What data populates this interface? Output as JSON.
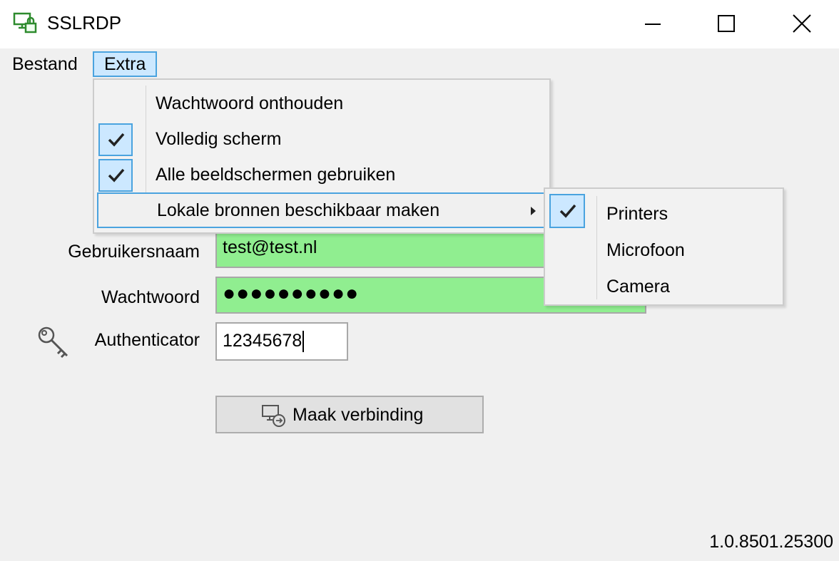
{
  "window": {
    "title": "SSLRDP",
    "app_icon": "monitor-lock-icon",
    "controls": [
      "minimize-icon",
      "maximize-icon",
      "close-icon"
    ],
    "accent_color": "#4aa3df"
  },
  "menubar": {
    "items": [
      {
        "label": "Bestand",
        "active": false
      },
      {
        "label": "Extra",
        "active": true
      }
    ]
  },
  "extra_menu": {
    "items": [
      {
        "label": "Wachtwoord onthouden",
        "checked": false
      },
      {
        "label": "Volledig scherm",
        "checked": true
      },
      {
        "label": "Alle beeldschermen gebruiken",
        "checked": true
      },
      {
        "label": "Lokale bronnen beschikbaar maken",
        "checked": false,
        "has_submenu": true,
        "highlighted": true
      }
    ]
  },
  "submenu": {
    "items": [
      {
        "label": "Printers",
        "checked": true
      },
      {
        "label": "Microfoon",
        "checked": false
      },
      {
        "label": "Camera",
        "checked": false
      }
    ]
  },
  "form": {
    "username_label": "Gebruikersnaam",
    "username_value": "test@test.nl",
    "password_label": "Wachtwoord",
    "password_value": "●●●●●●●●●●",
    "authenticator_label": "Authenticator",
    "authenticator_icon": "key-icon",
    "authenticator_value": "12345678",
    "valid_field_color": "#90ee90"
  },
  "connect_button": {
    "label": "Maak verbinding",
    "icon": "monitor-connect-icon"
  },
  "version": "1.0.8501.25300"
}
